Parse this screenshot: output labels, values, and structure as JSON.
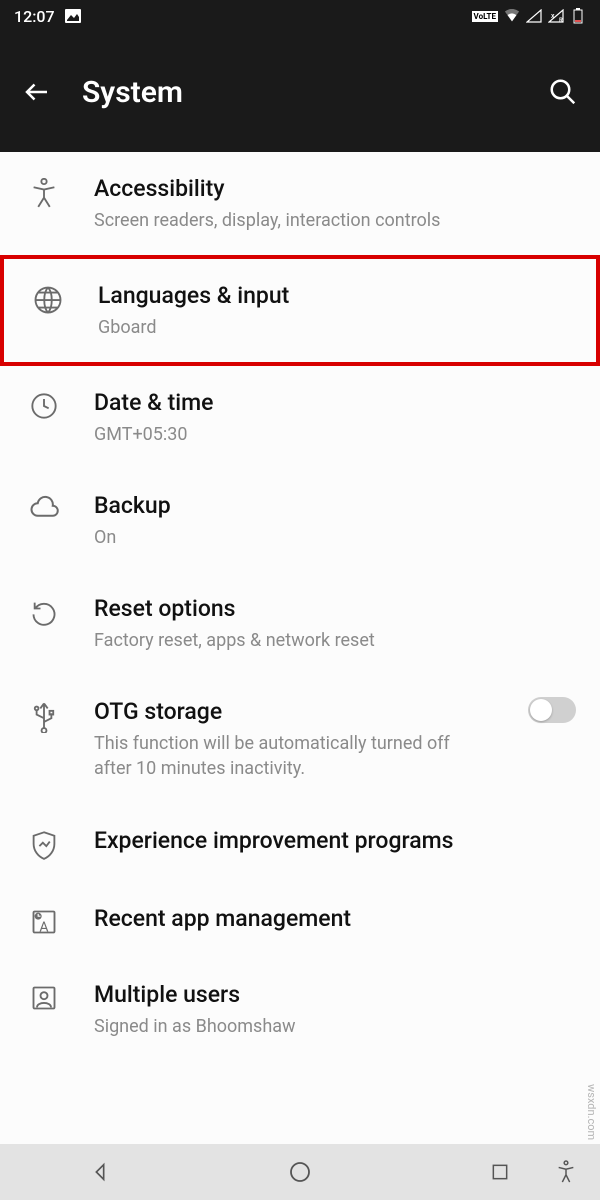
{
  "status": {
    "time": "12:07",
    "volte": "VoLTE"
  },
  "header": {
    "title": "System"
  },
  "items": [
    {
      "icon": "accessibility",
      "title": "Accessibility",
      "subtitle": "Screen readers, display, interaction controls"
    },
    {
      "icon": "globe",
      "title": "Languages & input",
      "subtitle": "Gboard",
      "highlighted": true
    },
    {
      "icon": "clock",
      "title": "Date & time",
      "subtitle": "GMT+05:30"
    },
    {
      "icon": "cloud",
      "title": "Backup",
      "subtitle": "On"
    },
    {
      "icon": "reset",
      "title": "Reset options",
      "subtitle": "Factory reset, apps & network reset"
    },
    {
      "icon": "usb",
      "title": "OTG storage",
      "subtitle": "This function will be automatically turned off after 10 minutes inactivity.",
      "toggle": false
    },
    {
      "icon": "shield",
      "title": "Experience improvement programs"
    },
    {
      "icon": "recent",
      "title": "Recent app management"
    },
    {
      "icon": "user",
      "title": "Multiple users",
      "subtitle": "Signed in as Bhoomshaw"
    }
  ],
  "watermark": "wsxdn.com"
}
